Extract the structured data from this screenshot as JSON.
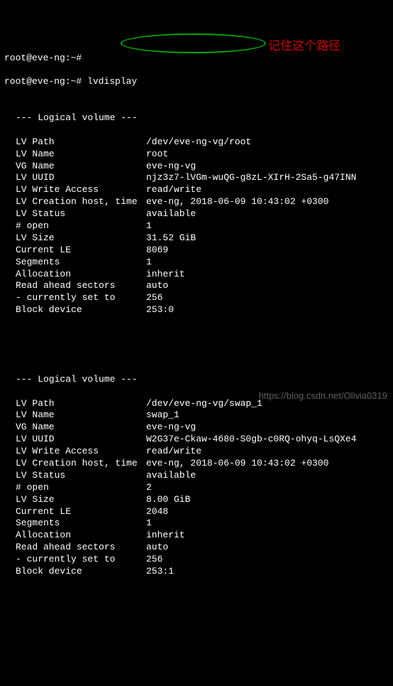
{
  "prompt1": "root@eve-ng:~#",
  "prompt2": "root@eve-ng:~# lvdisplay",
  "annotation": "记住这个路径",
  "watermark": "https://blog.csdn.net/Olivia0319",
  "lv1": {
    "header": "--- Logical volume ---",
    "rows": [
      {
        "label": "LV Path",
        "value": "/dev/eve-ng-vg/root"
      },
      {
        "label": "LV Name",
        "value": "root"
      },
      {
        "label": "VG Name",
        "value": "eve-ng-vg"
      },
      {
        "label": "LV UUID",
        "value": "njz3z7-lVGm-wuQG-g8zL-XIrH-2Sa5-g47INN"
      },
      {
        "label": "LV Write Access",
        "value": "read/write"
      },
      {
        "label": "LV Creation host, time",
        "value": "eve-ng, 2018-06-09 10:43:02 +0300"
      },
      {
        "label": "LV Status",
        "value": "available"
      },
      {
        "label": "# open",
        "value": "1"
      },
      {
        "label": "LV Size",
        "value": "31.52 GiB"
      },
      {
        "label": "Current LE",
        "value": "8069"
      },
      {
        "label": "Segments",
        "value": "1"
      },
      {
        "label": "Allocation",
        "value": "inherit"
      },
      {
        "label": "Read ahead sectors",
        "value": "auto"
      },
      {
        "label": "- currently set to",
        "value": "256"
      },
      {
        "label": "Block device",
        "value": "253:0"
      }
    ]
  },
  "lv2": {
    "header": "--- Logical volume ---",
    "rows": [
      {
        "label": "LV Path",
        "value": "/dev/eve-ng-vg/swap_1"
      },
      {
        "label": "LV Name",
        "value": "swap_1"
      },
      {
        "label": "VG Name",
        "value": "eve-ng-vg"
      },
      {
        "label": "LV UUID",
        "value": "W2G37e-Ckaw-4680-S0gb-c0RQ-ohyq-LsQXe4"
      },
      {
        "label": "LV Write Access",
        "value": "read/write"
      },
      {
        "label": "LV Creation host, time",
        "value": "eve-ng, 2018-06-09 10:43:02 +0300"
      },
      {
        "label": "LV Status",
        "value": "available"
      },
      {
        "label": "# open",
        "value": "2"
      },
      {
        "label": "LV Size",
        "value": "8.00 GiB"
      },
      {
        "label": "Current LE",
        "value": "2048"
      },
      {
        "label": "Segments",
        "value": "1"
      },
      {
        "label": "Allocation",
        "value": "inherit"
      },
      {
        "label": "Read ahead sectors",
        "value": "auto"
      },
      {
        "label": "- currently set to",
        "value": "256"
      },
      {
        "label": "Block device",
        "value": "253:1"
      }
    ]
  }
}
